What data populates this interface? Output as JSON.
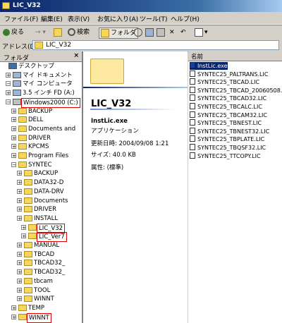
{
  "window": {
    "title": "LIC_V32"
  },
  "menu": [
    "ファイル(F)",
    "編集(E)",
    "表示(V)",
    "お気に入り(A)",
    "ツール(T)",
    "ヘルプ(H)"
  ],
  "toolbar": {
    "back": "戻る",
    "search": "検索",
    "folders": "フォルダ"
  },
  "address": {
    "label": "アドレス(D)",
    "value": "LIC_V32"
  },
  "folder_panel": {
    "title": "フォルダ",
    "close": "×",
    "items": [
      {
        "label": "デスクトップ",
        "level": 0
      },
      {
        "label": "マイ ドキュメント",
        "level": 1
      },
      {
        "label": "マイ コンピュータ",
        "level": 1
      },
      {
        "label": "3.5 インチ FD (A:)",
        "level": 2
      },
      {
        "label": "Windows2000 (C:)",
        "level": 2,
        "highlight": true
      },
      {
        "label": "BACKUP",
        "level": 3
      },
      {
        "label": "DELL",
        "level": 3
      },
      {
        "label": "Documents and",
        "level": 3
      },
      {
        "label": "DRIVER",
        "level": 3
      },
      {
        "label": "KPCMS",
        "level": 3
      },
      {
        "label": "Program Files",
        "level": 3
      },
      {
        "label": "SYNTEC",
        "level": 3
      },
      {
        "label": "BACKUP",
        "level": 4
      },
      {
        "label": "DATA32-D",
        "level": 4
      },
      {
        "label": "DATA-DRV",
        "level": 4
      },
      {
        "label": "Documents",
        "level": 4
      },
      {
        "label": "DRIVER",
        "level": 4
      },
      {
        "label": "INSTALL",
        "level": 4
      },
      {
        "label": "LIC_V32",
        "level": 5,
        "highlight": true
      },
      {
        "label": "LIC_Ver7",
        "level": 5,
        "highlight": true
      },
      {
        "label": "MANUAL",
        "level": 4
      },
      {
        "label": "TBCAD",
        "level": 4
      },
      {
        "label": "TBCAD32_",
        "level": 4
      },
      {
        "label": "TBCAD32_",
        "level": 4
      },
      {
        "label": "tbcam",
        "level": 4
      },
      {
        "label": "TOOL",
        "level": 4
      },
      {
        "label": "WINNT",
        "level": 4
      },
      {
        "label": "TEMP",
        "level": 3
      },
      {
        "label": "WINNT",
        "level": 3,
        "highlight": true
      }
    ]
  },
  "detail": {
    "folder_title": "LIC_V32",
    "file_name": "InstLic.exe",
    "file_type": "アプリケーション",
    "modified": "更新日時: 2004/09/08 1:21",
    "size": "サイズ: 40.0 KB",
    "attributes": "属性: (標準)"
  },
  "files": {
    "column": "名前",
    "items": [
      "InstLic.exe",
      "SYNTEC25_PALTRANS.LIC",
      "SYNTEC25_TBCAD.LIC",
      "SYNTEC25_TBCAD_20060508...",
      "SYNTEC25_TBCAD32.LIC",
      "SYNTEC25_TBCALC.LIC",
      "SYNTEC25_TBCAM32.LIC",
      "SYNTEC25_TBNEST.LIC",
      "SYNTEC25_TBNEST32.LIC",
      "SYNTEC25_TBPLATE.LIC",
      "SYNTEC25_TBQSF32.LIC",
      "SYNTEC25_TTCOPY.LIC"
    ]
  }
}
